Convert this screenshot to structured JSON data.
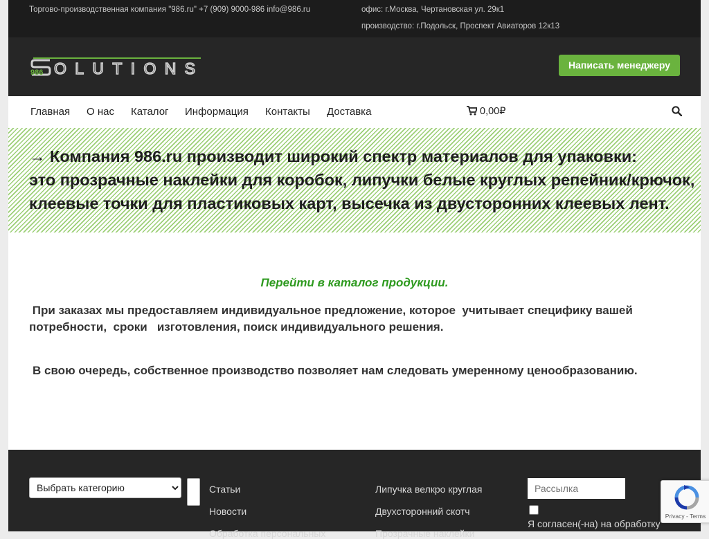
{
  "topbar": {
    "company": "Торгово-производственная компания \"986.ru\" +7 (909) 9000-986 info@986.ru",
    "office": "офис: г.Москва, Чертановская ул. 29к1",
    "production": "производство: г.Подольск, Проспект Авиаторов 12к13"
  },
  "header": {
    "logo_number": "986",
    "logo_text": "OLUTIONS",
    "manager_button": "Написать менеджеру"
  },
  "nav": {
    "items": [
      "Главная",
      "О нас",
      "Каталог",
      "Информация",
      "Контакты",
      "Доставка"
    ],
    "cart_total": "0,00₽"
  },
  "banner": {
    "line1": "→ Компания 986.ru производит широкий спектр материалов для упаковки:",
    "line2": "это прозрачные наклейки для коробок, липучки белые круглых репейник/крючок,",
    "line3": "клеевые точки для пластиковых карт, высечка из двусторонних клеевых лент."
  },
  "content": {
    "catalog_link": "Перейти в каталог продукции.",
    "paragraph1": " При заказах мы предоставляем индивидуальное предложение, которое  учитывает специфику вашей потребности,  сроки   изготовления, поиск индивидуального решения.",
    "paragraph2": "В свою очередь, собственное производство позволяет нам следовать умеренному ценообразованию."
  },
  "footer": {
    "category_select": "Выбрать категорию",
    "col2": [
      "Статьи",
      "Новости",
      "Обработка персональных"
    ],
    "col3": [
      "Липучка велкро круглая",
      "Двухсторонний скотч",
      "Прозрачные наклейки"
    ],
    "newsletter_placeholder": "Рассылка",
    "agree_text": "Я согласен(-на) на обработку"
  },
  "recaptcha": {
    "terms": "Privacy - Terms"
  },
  "colors": {
    "accent_green": "#6ab33e",
    "link_green": "#2e9a1f",
    "dark_bg": "#262626",
    "topbar_bg": "#1c1c1c"
  },
  "icons": [
    "cart-icon",
    "search-icon",
    "recaptcha-icon"
  ]
}
